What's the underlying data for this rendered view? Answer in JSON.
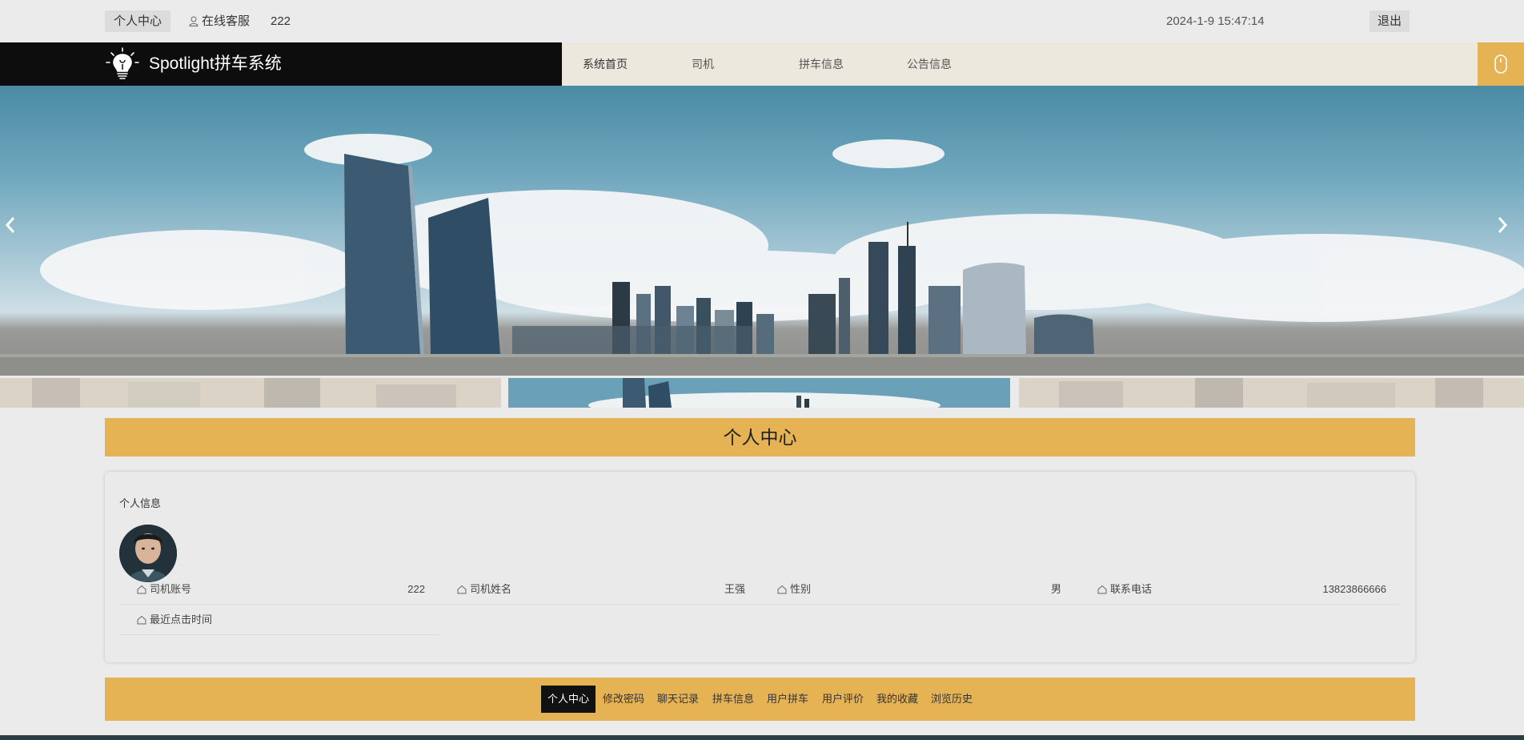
{
  "topbar": {
    "personal_center": "个人中心",
    "customer_service": "在线客服",
    "username": "222",
    "datetime": "2024-1-9 15:47:14",
    "logout": "退出"
  },
  "brand": {
    "title": "Spotlight拼车系统",
    "logo_icon": "lightbulb-icon"
  },
  "nav": {
    "items": [
      {
        "label": "系统首页"
      },
      {
        "label": "司机"
      },
      {
        "label": "拼车信息"
      },
      {
        "label": "公告信息"
      }
    ],
    "side_icon": "mouse-icon"
  },
  "section": {
    "title": "个人中心"
  },
  "card": {
    "title": "个人信息",
    "fields": [
      {
        "label": "司机账号",
        "value": "222"
      },
      {
        "label": "司机姓名",
        "value": "王强"
      },
      {
        "label": "性别",
        "value": "男"
      },
      {
        "label": "联系电话",
        "value": "13823866666"
      },
      {
        "label": "最近点击时间",
        "value": ""
      }
    ]
  },
  "tabs": [
    {
      "label": "个人中心",
      "active": true
    },
    {
      "label": "修改密码"
    },
    {
      "label": "聊天记录"
    },
    {
      "label": "拼车信息"
    },
    {
      "label": "用户拼车"
    },
    {
      "label": "用户评价"
    },
    {
      "label": "我的收藏"
    },
    {
      "label": "浏览历史"
    }
  ],
  "colors": {
    "accent": "#e5b254",
    "brand_bg": "#0d0d0d",
    "nav_bg": "#ede8dd",
    "page_bg": "#ebebeb"
  }
}
